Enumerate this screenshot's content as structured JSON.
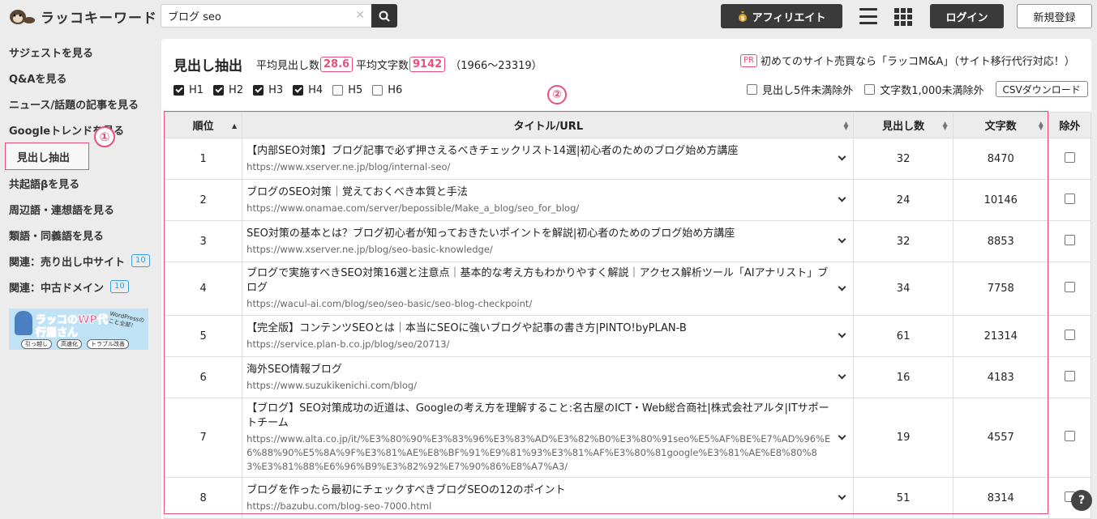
{
  "header": {
    "logo_text": "ラッコキーワード",
    "search_value": "ブログ seo",
    "affiliate_label": "アフィリエイト",
    "login_label": "ログイン",
    "register_label": "新規登録"
  },
  "sidebar": {
    "items": [
      {
        "label": "サジェストを見る"
      },
      {
        "label": "Q&Aを見る"
      },
      {
        "label": "ニュース/話題の記事を見る"
      },
      {
        "label": "Googleトレンドを見る"
      },
      {
        "label": "見出し抽出"
      },
      {
        "label": "共起語βを見る"
      },
      {
        "label": "周辺語・連想語を見る"
      },
      {
        "label": "類語・同義語を見る"
      },
      {
        "label": "関連：売り出し中サイト",
        "badge": "10"
      },
      {
        "label": "関連：中古ドメイン",
        "badge": "10"
      }
    ],
    "annotation_1": "①",
    "banner": {
      "title": "ラッコのWP代行屋さん",
      "subtitle": "WordPressのこと全部！",
      "tags": [
        "引っ越し",
        "高速化",
        "トラブル改善"
      ]
    }
  },
  "main": {
    "title": "見出し抽出",
    "avg_headings_label": "平均見出し数",
    "avg_headings_value": "28.6",
    "avg_chars_label": "平均文字数",
    "avg_chars_value": "9142",
    "chars_range": "（1966〜23319）",
    "pr_badge": "PR",
    "pr_text": "初めてのサイト売買なら「ラッコM&A」（サイト移行代行対応！）",
    "filters": [
      {
        "label": "H1",
        "checked": true
      },
      {
        "label": "H2",
        "checked": true
      },
      {
        "label": "H3",
        "checked": true
      },
      {
        "label": "H4",
        "checked": true
      },
      {
        "label": "H5",
        "checked": false
      },
      {
        "label": "H6",
        "checked": false
      }
    ],
    "exclude_headings_label": "見出し5件未満除外",
    "exclude_chars_label": "文字数1,000未満除外",
    "csv_label": "CSVダウンロード",
    "annotation_2": "②",
    "columns": {
      "rank": "順位",
      "title": "タイトル/URL",
      "count": "見出し数",
      "chars": "文字数",
      "exclude": "除外"
    },
    "rows": [
      {
        "rank": "1",
        "title": "【内部SEO対策】ブログ記事で必ず押さえるべきチェックリスト14選|初心者のためのブログ始め方講座",
        "url": "https://www.xserver.ne.jp/blog/internal-seo/",
        "count": "32",
        "chars": "8470"
      },
      {
        "rank": "2",
        "title": "ブログのSEO対策｜覚えておくべき本質と手法",
        "url": "https://www.onamae.com/server/bepossible/Make_a_blog/seo_for_blog/",
        "count": "24",
        "chars": "10146"
      },
      {
        "rank": "3",
        "title": "SEO対策の基本とは？ブログ初心者が知っておきたいポイントを解説|初心者のためのブログ始め方講座",
        "url": "https://www.xserver.ne.jp/blog/seo-basic-knowledge/",
        "count": "32",
        "chars": "8853"
      },
      {
        "rank": "4",
        "title": "ブログで実施すべきSEO対策16選と注意点｜基本的な考え方もわかりやすく解説｜アクセス解析ツール「AIアナリスト」ブログ",
        "url": "https://wacul-ai.com/blog/seo/seo-basic/seo-blog-checkpoint/",
        "count": "34",
        "chars": "7758"
      },
      {
        "rank": "5",
        "title": "【完全版】コンテンツSEOとは｜本当にSEOに強いブログや記事の書き方|PINTO!byPLAN-B",
        "url": "https://service.plan-b.co.jp/blog/seo/20713/",
        "count": "61",
        "chars": "21314"
      },
      {
        "rank": "6",
        "title": "海外SEO情報ブログ",
        "url": "https://www.suzukikenichi.com/blog/",
        "count": "16",
        "chars": "4183"
      },
      {
        "rank": "7",
        "title": "【ブログ】SEO対策成功の近道は、Googleの考え方を理解すること:名古屋のICT・Web総合商社|株式会社アルタ|ITサポートチーム",
        "url": "https://www.alta.co.jp/it/%E3%80%90%E3%83%96%E3%83%AD%E3%82%B0%E3%80%91seo%E5%AF%BE%E7%AD%96%E6%88%90%E5%8A%9F%E3%81%AE%E8%BF%91%E9%81%93%E3%81%AF%E3%80%81google%E3%81%AE%E8%80%83%E3%81%88%E6%96%B9%E3%82%92%E7%90%86%E8%A7%A3/",
        "count": "19",
        "chars": "4557"
      },
      {
        "rank": "8",
        "title": "ブログを作ったら最初にチェックすべきブログSEOの12のポイント",
        "url": "https://bazubu.com/blog-seo-7000.html",
        "count": "51",
        "chars": "8314"
      }
    ],
    "help_label": "?"
  }
}
